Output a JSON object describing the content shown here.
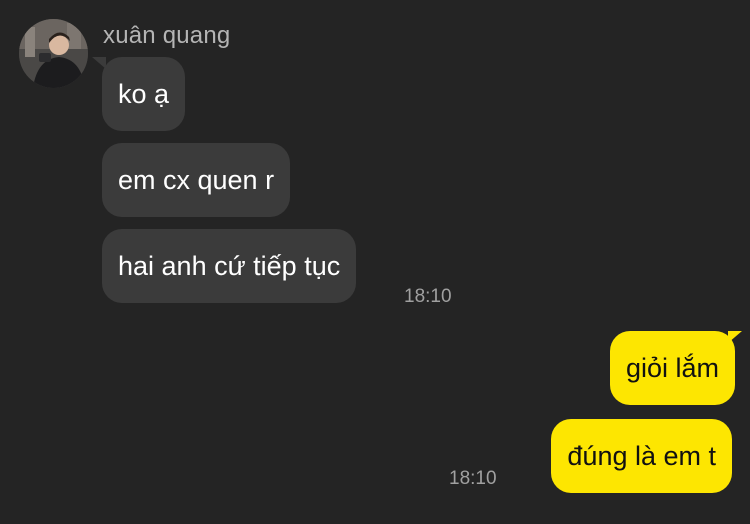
{
  "conversation": {
    "sender": {
      "name": "xuân quang",
      "avatar_icon": "user-photo-icon"
    },
    "incoming": [
      {
        "text": "ko ạ"
      },
      {
        "text": "em cx quen r"
      },
      {
        "text": "hai anh cứ tiếp tục"
      }
    ],
    "incoming_time": "18:10",
    "outgoing": [
      {
        "text": "giỏi lắm"
      },
      {
        "text": "đúng là em t"
      }
    ],
    "outgoing_time": "18:10"
  },
  "colors": {
    "background": "#242424",
    "incoming_bubble": "#3b3b3b",
    "outgoing_bubble": "#fde601",
    "timestamp": "#a0a0a0"
  }
}
